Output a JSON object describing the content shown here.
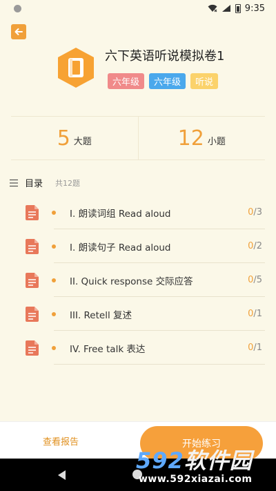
{
  "status_bar": {
    "time": "9:35"
  },
  "header": {
    "title": "六下英语听说模拟卷1",
    "tags": [
      "六年级",
      "六年级",
      "听说"
    ]
  },
  "stats": [
    {
      "number": "5",
      "label": "大题"
    },
    {
      "number": "12",
      "label": "小题"
    }
  ],
  "toc": {
    "title": "目录",
    "count": "共12题",
    "items": [
      {
        "label": "I. 朗读词组 Read aloud",
        "done": "0",
        "total": "/3"
      },
      {
        "label": "I. 朗读句子 Read aloud",
        "done": "0",
        "total": "/2"
      },
      {
        "label": "II. Quick response 交际应答",
        "done": "0",
        "total": "/5"
      },
      {
        "label": "III. Retell 复述",
        "done": "0",
        "total": "/1"
      },
      {
        "label": "IV. Free talk 表达",
        "done": "0",
        "total": "/1"
      }
    ]
  },
  "bottom": {
    "report_label": "查看报告",
    "start_label": "开始练习"
  },
  "watermark": {
    "brand_num": "592",
    "brand_cn": "软件园",
    "url": "www.592xiazai.com"
  },
  "colors": {
    "accent": "#f0a03a",
    "tag_red": "#f08a8a",
    "tag_blue": "#4aa8ec",
    "tag_yellow": "#fbd26b",
    "doc_icon": "#e8785a"
  }
}
